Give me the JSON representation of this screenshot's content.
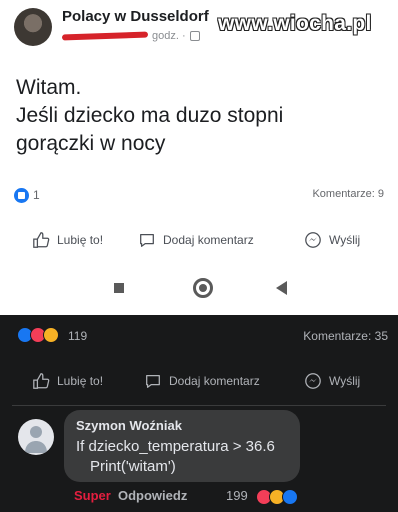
{
  "header": {
    "group_name": "Polacy w Dusseldorf",
    "time": "godz. ·",
    "watermark": "www.wiocha.pl"
  },
  "post": {
    "lines": [
      "Witam.",
      "Jeśli dziecko ma duzo stopni",
      "gorączki w nocy"
    ],
    "reaction_count": "1",
    "comments_label": "Komentarze: 9"
  },
  "actions": {
    "like": "Lubię to!",
    "comment": "Dodaj komentarz",
    "share": "Wyślij"
  },
  "dark_post": {
    "reaction_count": "119",
    "comments_label": "Komentarze: 35",
    "like": "Lubię to!",
    "comment": "Dodaj komentarz",
    "share": "Wyślij"
  },
  "comment": {
    "author": "Szymon Woźniak",
    "line1": "If dziecko_temperatura > 36.6",
    "line2": "Print('witam')",
    "super": "Super",
    "reply": "Odpowiedz",
    "reaction_count": "199"
  },
  "colors": {
    "brand_blue": "#1877f2",
    "super_red": "#e41e3f",
    "dark_bg": "#18191a"
  }
}
